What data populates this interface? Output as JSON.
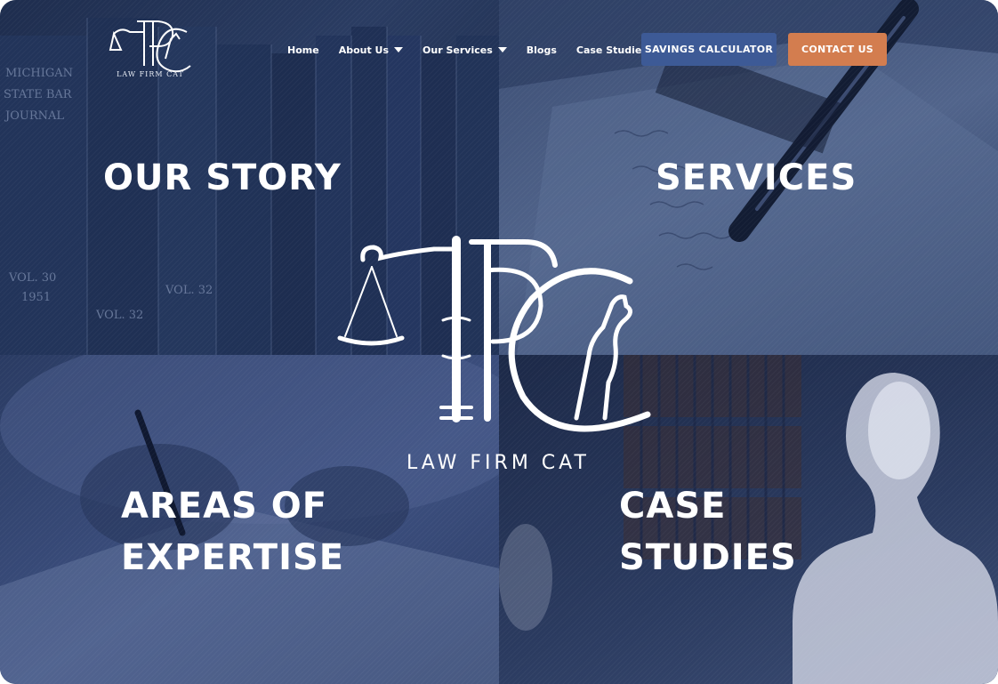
{
  "brand": {
    "logo_text": "LAW FIRM CAT",
    "colors": {
      "background": "#243559",
      "calculator_button": "#3d5a96",
      "contact_button": "#d37d4f",
      "text": "#ffffff"
    }
  },
  "nav": {
    "items": [
      {
        "label": "Home",
        "has_dropdown": false
      },
      {
        "label": "About Us",
        "has_dropdown": true
      },
      {
        "label": "Our Services",
        "has_dropdown": true
      },
      {
        "label": "Blogs",
        "has_dropdown": false
      },
      {
        "label": "Case Studies",
        "has_dropdown": false
      }
    ]
  },
  "buttons": {
    "calculator": "SAVINGS CALCULATOR",
    "contact": "CONTACT US"
  },
  "tiles": {
    "our_story": "OUR STORY",
    "services": "SERVICES",
    "areas_line1": "AREAS OF",
    "areas_line2": "EXPERTISE",
    "case_line1": "CASE",
    "case_line2": "STUDIES"
  },
  "backgrounds": {
    "book_spine_1": "MICHIGAN",
    "book_spine_2": "STATE BAR",
    "book_spine_3": "JOURNAL",
    "book_vol_1": "VOL. 30",
    "book_year_1": "1951",
    "book_vol_2": "VOL. 32",
    "book_vol_3": "VOL. 32"
  }
}
